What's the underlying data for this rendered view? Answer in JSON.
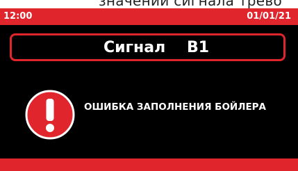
{
  "header_clip": {
    "text": "значений сигнала трево"
  },
  "status_bar": {
    "time": "12:00",
    "date": "01/01/21"
  },
  "signal": {
    "label": "Сигнал",
    "code": "B1"
  },
  "alert": {
    "icon": "exclamation-icon",
    "message": "ОШИБКА ЗАПОЛНЕНИЯ БОЙЛЕРА"
  },
  "colors": {
    "accent": "#e0262c",
    "background": "#000000",
    "text": "#ffffff"
  }
}
